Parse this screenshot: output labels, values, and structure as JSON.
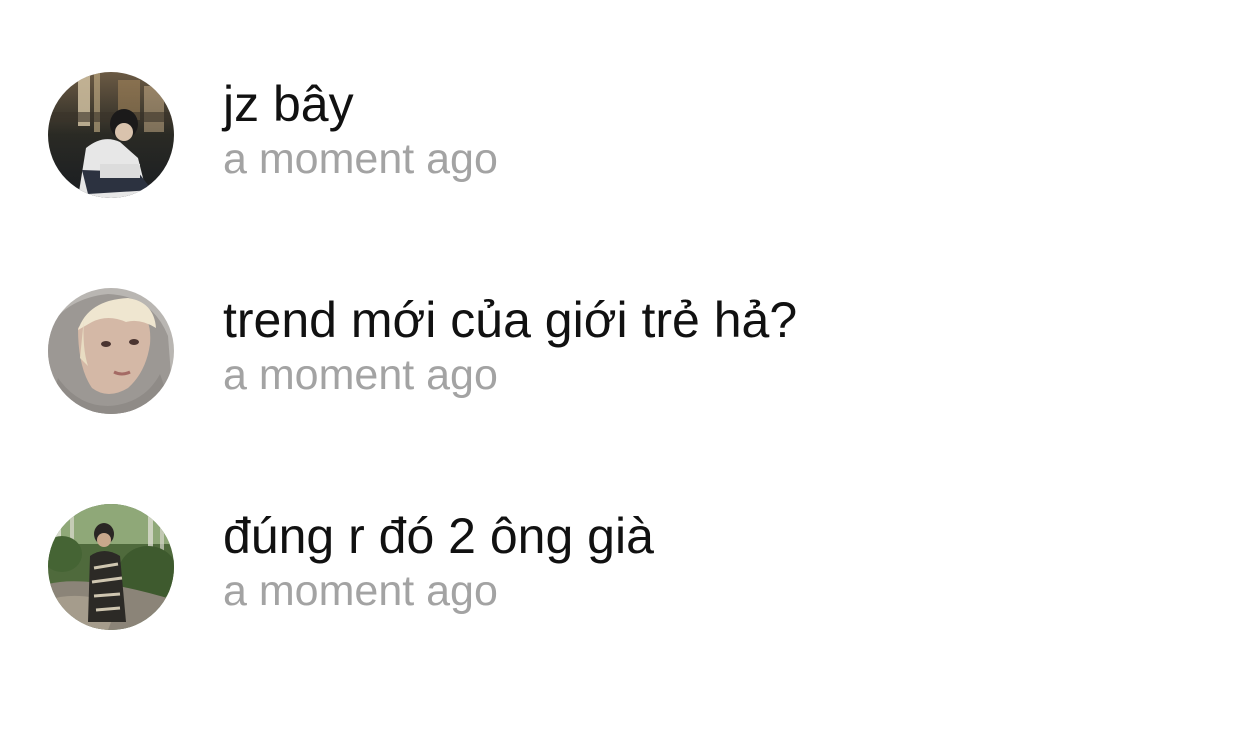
{
  "comments": [
    {
      "text": "jz bây",
      "time": "a moment ago",
      "avatar_icon": "user-photo-night-city"
    },
    {
      "text": "trend mới của giới trẻ hả?",
      "time": "a moment ago",
      "avatar_icon": "user-photo-hoodie"
    },
    {
      "text": "đúng r đó 2 ông già",
      "time": "a moment ago",
      "avatar_icon": "user-photo-forest"
    }
  ],
  "colors": {
    "background": "#ffffff",
    "comment_text": "#111111",
    "timestamp_text": "#a3a3a3"
  }
}
